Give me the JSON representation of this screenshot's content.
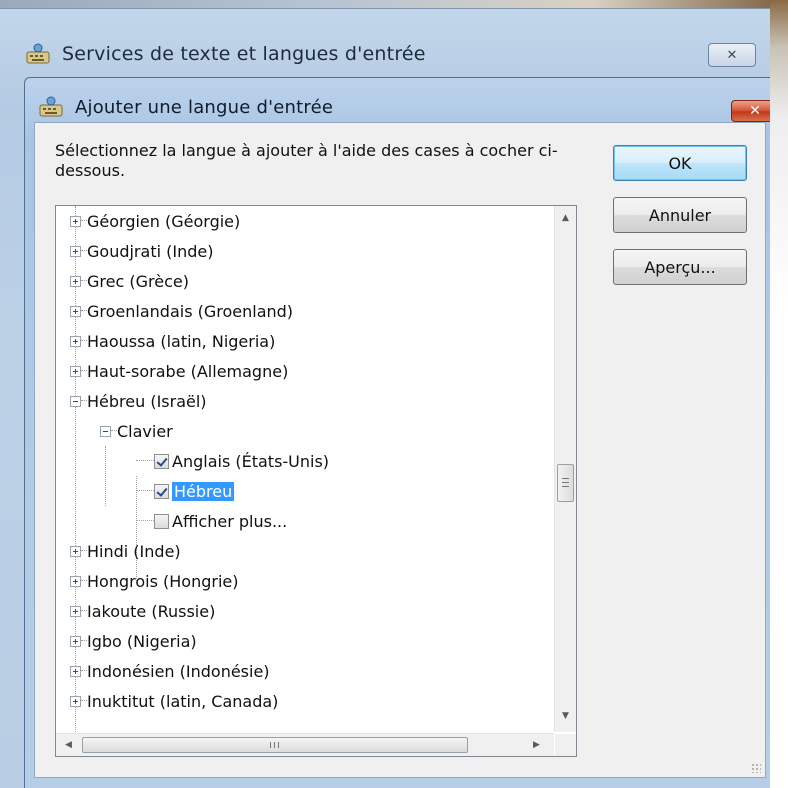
{
  "parent_window": {
    "title": "Services de texte et langues d'entrée",
    "close_icon": "close-icon"
  },
  "dialog": {
    "title": "Ajouter une langue d'entrée",
    "instructions": "Sélectionnez la langue à ajouter à l'aide des cases à cocher ci-dessous."
  },
  "tree": {
    "items": [
      {
        "label": "Géorgien (Géorgie)",
        "state": "collapsed"
      },
      {
        "label": "Goudjrati (Inde)",
        "state": "collapsed"
      },
      {
        "label": "Grec (Grèce)",
        "state": "collapsed"
      },
      {
        "label": "Groenlandais (Groenland)",
        "state": "collapsed"
      },
      {
        "label": "Haoussa (latin, Nigeria)",
        "state": "collapsed"
      },
      {
        "label": "Haut-sorabe (Allemagne)",
        "state": "collapsed"
      },
      {
        "label": "Hébreu (Israël)",
        "state": "expanded"
      },
      {
        "label": "Clavier",
        "state": "expanded"
      },
      {
        "label": "Anglais (États-Unis)",
        "checked": true
      },
      {
        "label": "Hébreu",
        "checked": true,
        "selected": true
      },
      {
        "label": "Afficher plus...",
        "checked": false
      },
      {
        "label": "Hindi (Inde)",
        "state": "collapsed"
      },
      {
        "label": "Hongrois (Hongrie)",
        "state": "collapsed"
      },
      {
        "label": "Iakoute (Russie)",
        "state": "collapsed"
      },
      {
        "label": "Igbo (Nigeria)",
        "state": "collapsed"
      },
      {
        "label": "Indonésien (Indonésie)",
        "state": "collapsed"
      },
      {
        "label": "Inuktitut (latin, Canada)",
        "state": "collapsed"
      }
    ]
  },
  "buttons": {
    "ok": "OK",
    "cancel": "Annuler",
    "preview": "Aperçu..."
  },
  "scroll": {
    "up": "▲",
    "down": "▼",
    "left": "◀",
    "right": "▶",
    "h_grip": "III"
  },
  "colors": {
    "selection": "#3399ff",
    "close_button": "#c2391a",
    "dialog_frame": "#b2cbe6"
  }
}
